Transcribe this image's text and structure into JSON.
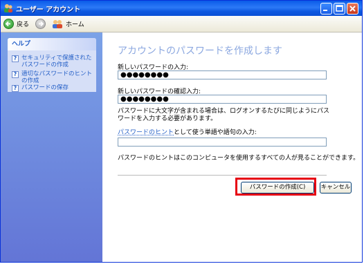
{
  "window": {
    "title": "ユーザー アカウント"
  },
  "toolbar": {
    "back_label": "戻る",
    "home_label": "ホーム"
  },
  "sidebar": {
    "help_title": "ヘルプ",
    "items": [
      {
        "label": "セキュリティで保護されたパスワードの作成"
      },
      {
        "label": "適切なパスワードのヒントの作成"
      },
      {
        "label": "パスワードの保存"
      }
    ]
  },
  "main": {
    "heading": "アカウントのパスワードを作成します",
    "new_password_label": "新しいパスワードの入力:",
    "new_password_value": "●●●●●●●●",
    "confirm_label": "新しいパスワードの確認入力:",
    "confirm_value": "●●●●●●●●",
    "caps_note": "パスワードに大文字が含まれる場合は、ログオンするたびに同じようにパスワードを入力する必要があります。",
    "hint_link": "パスワードのヒント",
    "hint_label_rest": "として使う単語や語句の入力:",
    "hint_value": "",
    "hint_note": "パスワードのヒントはこのコンピュータを使用するすべての人が見ることができます。",
    "create_button": "パスワードの作成(C)",
    "cancel_button": "キャンセル"
  },
  "colors": {
    "title_bar": "#0a5ce8",
    "sidebar": "#6f8fe0",
    "highlight": "#e60012",
    "link": "#215dc6"
  }
}
